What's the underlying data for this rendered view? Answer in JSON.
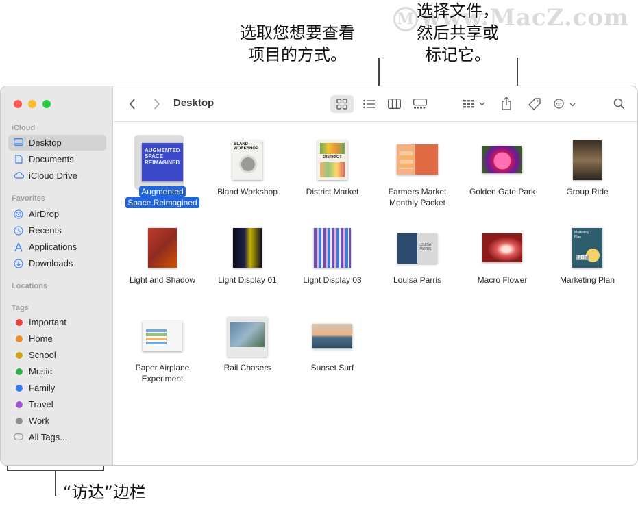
{
  "callouts": {
    "view_line1": "选取您想要查看",
    "view_line2": "项目的方式。",
    "share_line1": "选择文件，",
    "share_line2": "然后共享或",
    "share_line3": "标记它。",
    "sidebar": "“访达”边栏"
  },
  "watermark": "www.MacZ.com",
  "window": {
    "title": "Desktop"
  },
  "sidebar": {
    "icloud_header": "iCloud",
    "icloud_items": [
      {
        "label": "Desktop",
        "icon": "desktop-icon"
      },
      {
        "label": "Documents",
        "icon": "document-icon"
      },
      {
        "label": "iCloud Drive",
        "icon": "cloud-icon"
      }
    ],
    "favorites_header": "Favorites",
    "favorites_items": [
      {
        "label": "AirDrop",
        "icon": "airdrop-icon"
      },
      {
        "label": "Recents",
        "icon": "clock-icon"
      },
      {
        "label": "Applications",
        "icon": "applications-icon"
      },
      {
        "label": "Downloads",
        "icon": "download-icon"
      }
    ],
    "locations_header": "Locations",
    "tags_header": "Tags",
    "tags": [
      {
        "label": "Important",
        "color": "#e8413c"
      },
      {
        "label": "Home",
        "color": "#f28c28"
      },
      {
        "label": "School",
        "color": "#d4a017"
      },
      {
        "label": "Music",
        "color": "#2fb344"
      },
      {
        "label": "Family",
        "color": "#2f7cf6"
      },
      {
        "label": "Travel",
        "color": "#a553d6"
      },
      {
        "label": "Work",
        "color": "#8e8e93"
      }
    ],
    "all_tags": "All Tags..."
  },
  "files": [
    {
      "line1": "Augmented",
      "line2": "Space Reimagined",
      "selected": true
    },
    {
      "line1": "Bland Workshop",
      "line2": ""
    },
    {
      "line1": "District Market",
      "line2": ""
    },
    {
      "line1": "Farmers Market",
      "line2": "Monthly Packet"
    },
    {
      "line1": "Golden Gate Park",
      "line2": ""
    },
    {
      "line1": "Group Ride",
      "line2": ""
    },
    {
      "line1": "Light and Shadow",
      "line2": ""
    },
    {
      "line1": "Light Display 01",
      "line2": ""
    },
    {
      "line1": "Light Display 03",
      "line2": ""
    },
    {
      "line1": "Louisa Parris",
      "line2": ""
    },
    {
      "line1": "Macro Flower",
      "line2": ""
    },
    {
      "line1": "Marketing Plan",
      "line2": ""
    },
    {
      "line1": "Paper Airplane",
      "line2": "Experiment"
    },
    {
      "line1": "Rail Chasers",
      "line2": ""
    },
    {
      "line1": "Sunset Surf",
      "line2": ""
    }
  ],
  "thumb_text": {
    "augmented": "AUGMENTED SPACE REIMAGINED",
    "bland": "BLAND WORKSHOP",
    "district": "DISTRICT",
    "louisa": "LOUISA PARRIS",
    "marketing": "Marketing Plan",
    "marketing_badge": "PDF"
  },
  "colors": {
    "accent": "#2264d9",
    "sidebar_bg": "#e9e8e8"
  }
}
